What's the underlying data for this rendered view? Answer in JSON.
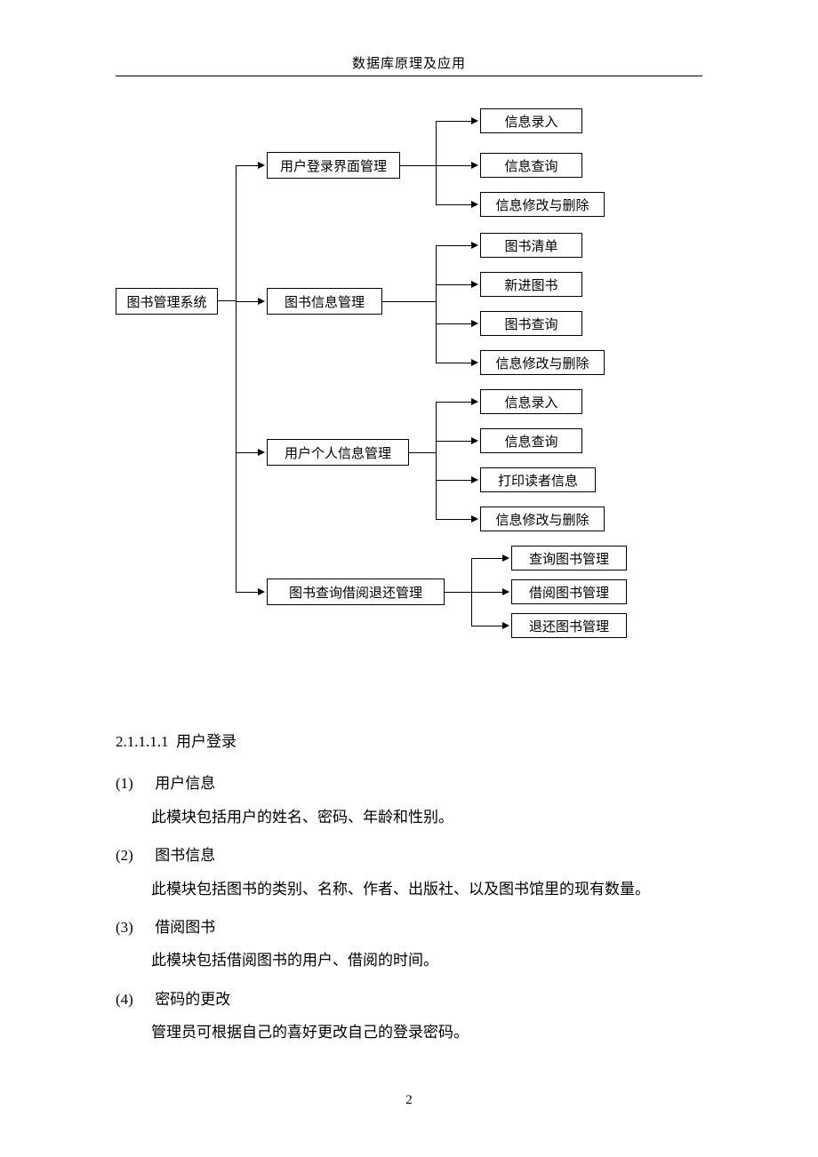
{
  "header": {
    "title": "数据库原理及应用"
  },
  "diagram": {
    "root": "图书管理系统",
    "branches": [
      {
        "label": "用户登录界面管理",
        "children": [
          "信息录入",
          "信息查询",
          "信息修改与删除"
        ]
      },
      {
        "label": "图书信息管理",
        "children": [
          "图书清单",
          "新进图书",
          "图书查询",
          "信息修改与删除"
        ]
      },
      {
        "label": "用户个人信息管理",
        "children": [
          "信息录入",
          "信息查询",
          "打印读者信息",
          "信息修改与删除"
        ]
      },
      {
        "label": "图书查询借阅退还管理",
        "children": [
          "查询图书管理",
          "借阅图书管理",
          "退还图书管理"
        ]
      }
    ]
  },
  "section": {
    "number": "2.1.1.1.1",
    "title": "用户登录",
    "items": [
      {
        "num": "(1)",
        "title": "用户信息",
        "desc": "此模块包括用户的姓名、密码、年龄和性别。"
      },
      {
        "num": "(2)",
        "title": "图书信息",
        "desc": "此模块包括图书的类别、名称、作者、出版社、以及图书馆里的现有数量。"
      },
      {
        "num": "(3)",
        "title": "借阅图书",
        "desc": "此模块包括借阅图书的用户、借阅的时间。"
      },
      {
        "num": "(4)",
        "title": "密码的更改",
        "desc": "管理员可根据自己的喜好更改自己的登录密码。"
      }
    ]
  },
  "pageNumber": "2"
}
